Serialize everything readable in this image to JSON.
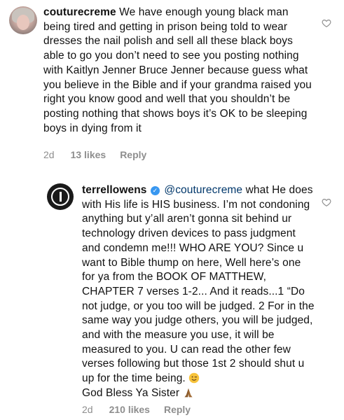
{
  "comments": [
    {
      "username": "couturecreme",
      "text": "We have enough young black man being tired and getting in prison being told to wear dresses the nail polish and sell all these black boys able to go you don’t need to see you posting nothing with Kaitlyn Jenner Bruce Jenner because guess what you believe in the Bible and if your grandma raised you right you know good and well that you shouldn’t be posting nothing that shows boys it’s OK to be sleeping boys in dying from it",
      "time": "2d",
      "likes": "13 likes",
      "reply": "Reply",
      "like_icon": "heart-outline-icon"
    },
    {
      "username": "terrellowens",
      "verified": true,
      "mention": "@couturecreme",
      "text": "what He does with His life is HIS business. I’m not condoning anything but y’all aren’t gonna sit behind ur technology driven devices to pass judgment and condemn me!!! WHO ARE YOU? Since u want to Bible thump on here, Well here’s one for ya from the BOOK OF MATTHEW, CHAPTER 7 verses 1-2... And it reads...1 “Do not judge, or you too will be judged. 2 For in the same way you judge others, you will be judged, and with the measure you use, it will be measured to you.  U can read the other few verses following but those 1st 2 should shut u up for the time being.",
      "closing": "God Bless Ya Sister",
      "time": "2d",
      "likes": "210 likes",
      "reply": "Reply",
      "like_icon": "heart-outline-icon"
    }
  ]
}
